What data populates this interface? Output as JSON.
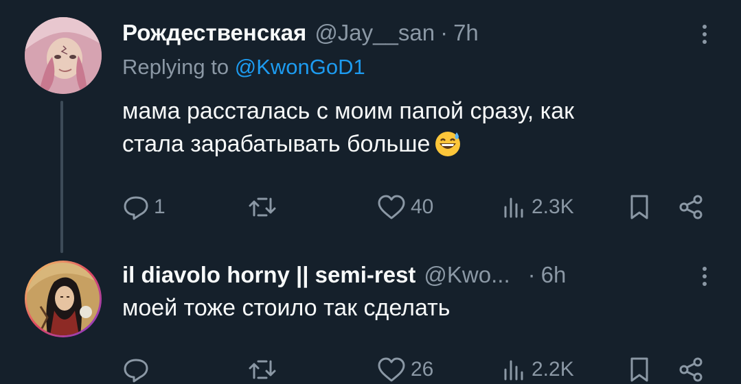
{
  "tweets": [
    {
      "name": "Рождественская",
      "handle": "@Jay__san",
      "separator": "·",
      "time": "7h",
      "replying_prefix": "Replying to ",
      "replying_to": "@KwonGoD1",
      "text_line1": "мама рассталась с моим папой сразу, как",
      "text_line2": "стала зарабатывать больше",
      "emoji": "grinning-sweat-emoji",
      "replies": "1",
      "retweets": "",
      "likes": "40",
      "views": "2.3K"
    },
    {
      "name": "il diavolo horny || semi-rest",
      "handle": "@Kwo...",
      "separator": "·",
      "time": "6h",
      "text_line1": "моей тоже стоило так сделать",
      "replies": "",
      "retweets": "",
      "likes": "26",
      "views": "2.2K"
    }
  ],
  "colors": {
    "background": "#15202b",
    "text_primary": "#f7f9f9",
    "text_secondary": "#8b98a5",
    "accent": "#1d9bf0",
    "thread_line": "#3d4b58"
  },
  "icons": [
    "reply-icon",
    "retweet-icon",
    "like-icon",
    "views-icon",
    "bookmark-icon",
    "share-icon",
    "more-icon"
  ]
}
